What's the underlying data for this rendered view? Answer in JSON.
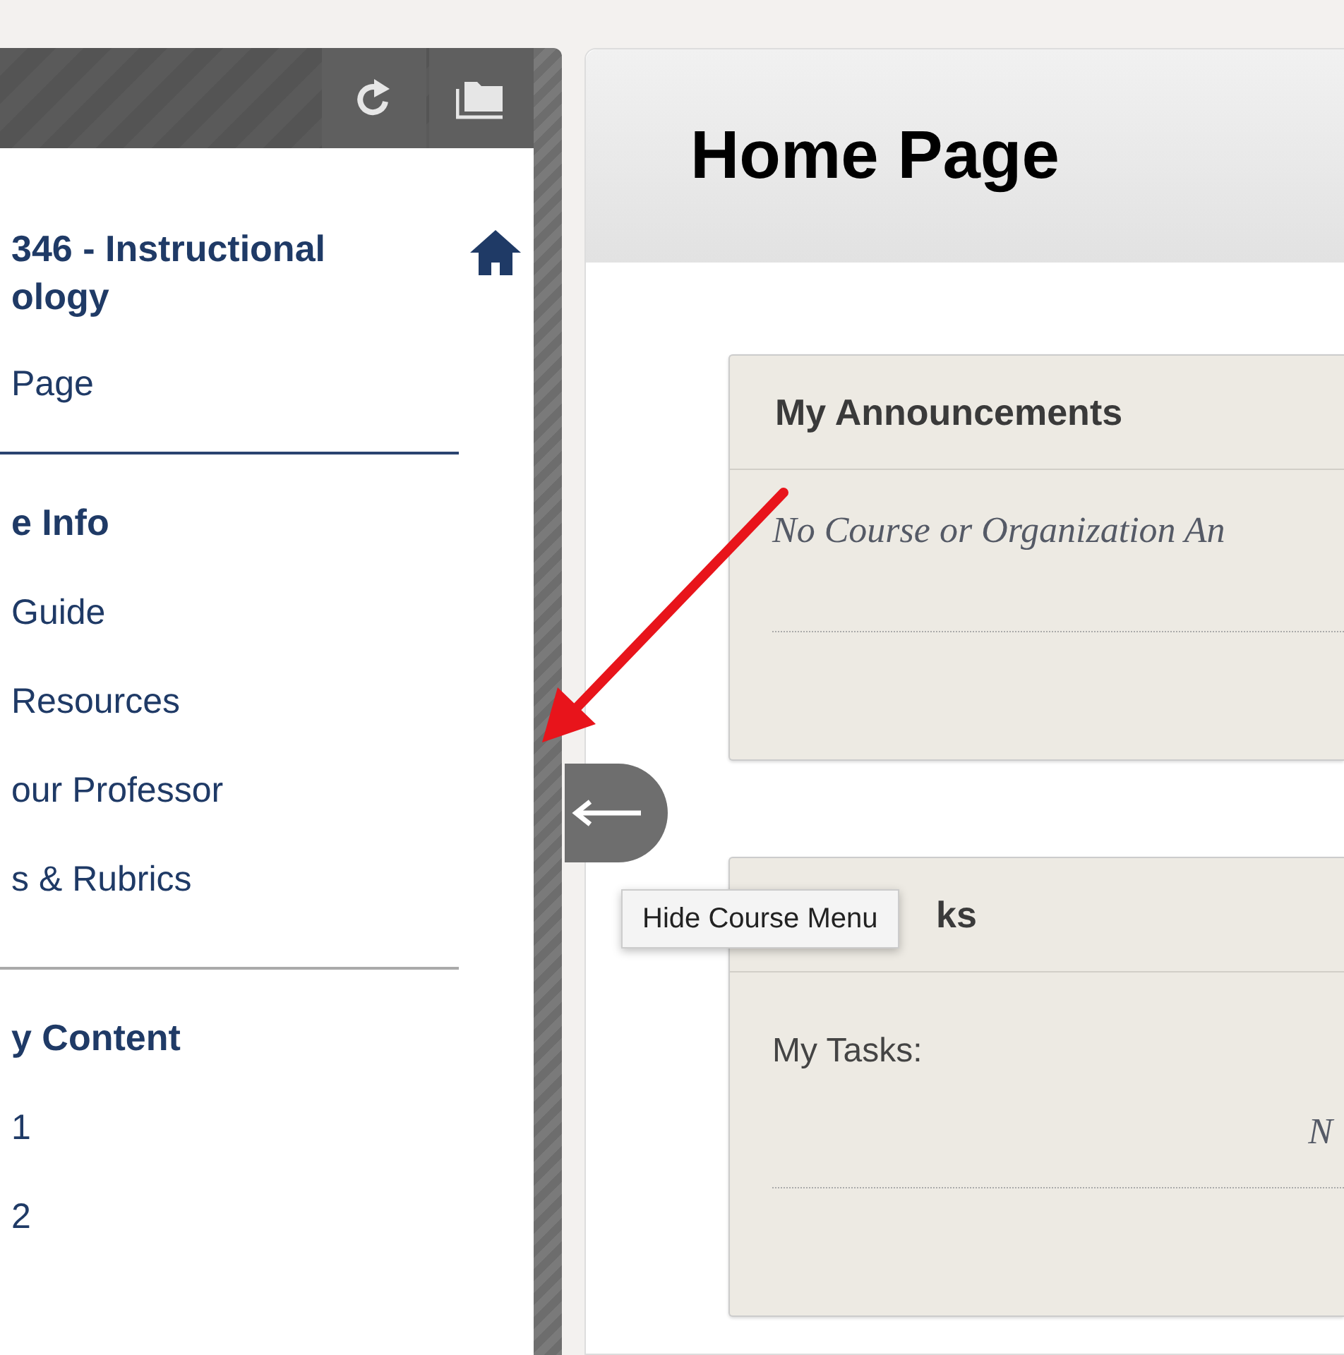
{
  "sidebar": {
    "toolbar": [
      {
        "kind": "refresh"
      },
      {
        "kind": "folder"
      }
    ],
    "course_title": [
      "346 - Instructional",
      "ology"
    ],
    "home_link": "Page",
    "sections": [
      {
        "heading": "e Info",
        "items": [
          "Guide",
          "Resources",
          "our Professor",
          "s & Rubrics"
        ]
      },
      {
        "heading": "y Content",
        "items": [
          "1",
          "2"
        ]
      }
    ]
  },
  "collapse_button": {
    "tooltip": "Hide Course Menu"
  },
  "page_title": "Home Page",
  "modules": [
    {
      "title": "My Announcements",
      "notice": "No Course or Organization An"
    },
    {
      "title": "ks",
      "label": "My Tasks:",
      "notice": "N"
    }
  ],
  "annotation": {
    "kind": "arrow"
  }
}
